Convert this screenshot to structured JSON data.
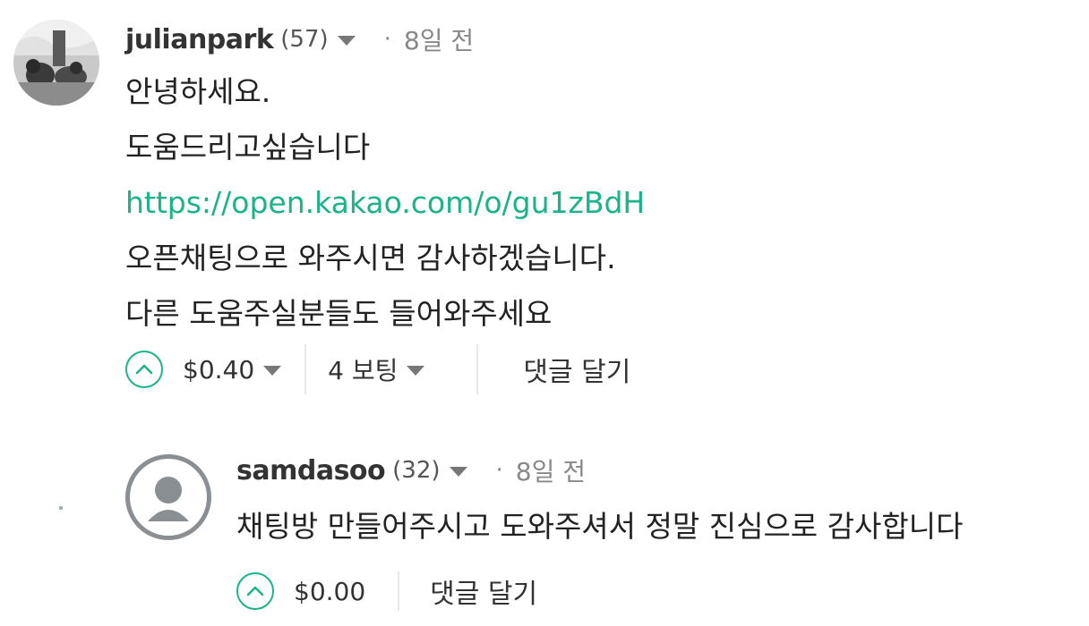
{
  "comments": [
    {
      "username": "julianpark",
      "reputation": "(57)",
      "separator": "·",
      "time": "8일 전",
      "lines": [
        "안녕하세요.",
        "도움드리고싶습니다",
        "https://open.kakao.com/o/gu1zBdH",
        "오픈채팅으로 와주시면 감사하겠습니다.",
        "다른 도움주실분들도 들어와주세요"
      ],
      "payout": "$0.40",
      "votes": "4 보팅",
      "reply_label": "댓글 달기"
    },
    {
      "username": "samdasoo",
      "reputation": "(32)",
      "separator": "·",
      "time": "8일 전",
      "lines": [
        "채팅방 만들어주시고 도와주셔서 정말 진심으로 감사합니다"
      ],
      "payout": "$0.00",
      "reply_label": "댓글 달기"
    }
  ],
  "colors": {
    "accent": "#1bb38a",
    "text": "#222222",
    "muted": "#888888"
  },
  "icons": {
    "upvote": "chevron-up-circle-icon",
    "dropdown": "caret-down-icon",
    "default_avatar": "person-silhouette-icon"
  }
}
